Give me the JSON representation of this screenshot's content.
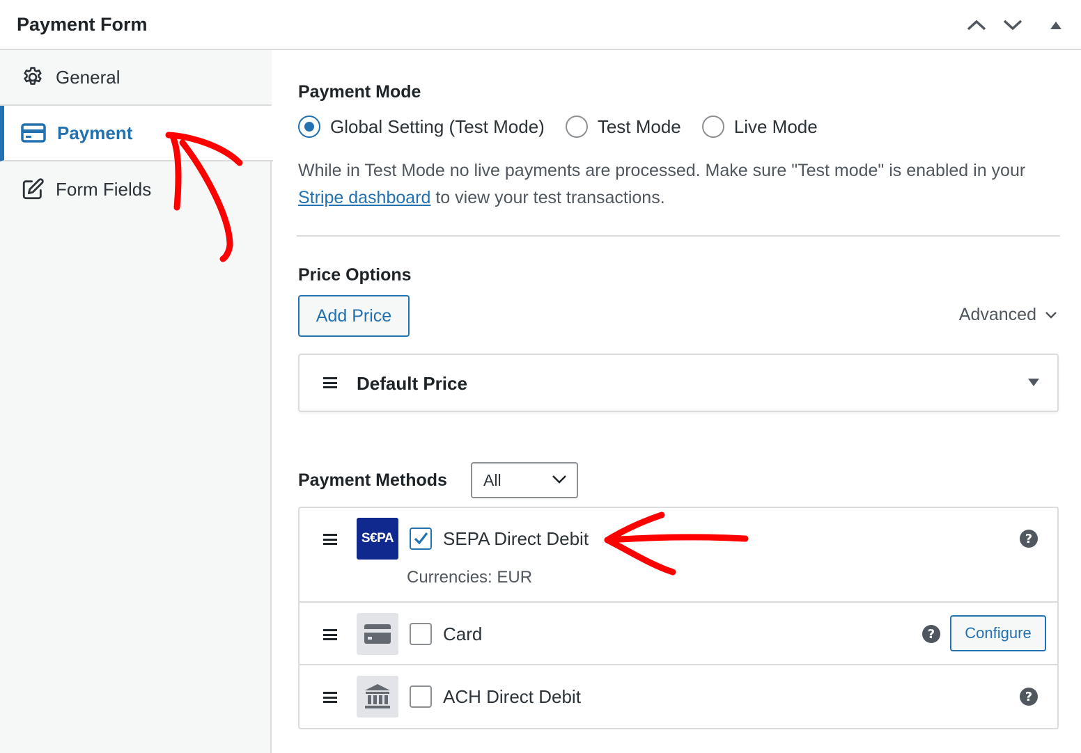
{
  "header": {
    "title": "Payment Form"
  },
  "sidebar": {
    "items": [
      {
        "label": "General",
        "icon": "gear-icon"
      },
      {
        "label": "Payment",
        "icon": "credit-card-icon",
        "active": true
      },
      {
        "label": "Form Fields",
        "icon": "edit-icon"
      }
    ]
  },
  "payment_mode": {
    "title": "Payment Mode",
    "options": [
      {
        "label": "Global Setting (Test Mode)",
        "checked": true
      },
      {
        "label": "Test Mode",
        "checked": false
      },
      {
        "label": "Live Mode",
        "checked": false
      }
    ],
    "description_before": "While in Test Mode no live payments are processed. Make sure \"Test mode\" is enabled in your ",
    "link_text": "Stripe dashboard",
    "description_after": " to view your test transactions."
  },
  "price_options": {
    "title": "Price Options",
    "add_button": "Add Price",
    "advanced_label": "Advanced",
    "default_price": "Default Price"
  },
  "payment_methods": {
    "label": "Payment Methods",
    "filter_value": "All",
    "methods": [
      {
        "name": "SEPA Direct Debit",
        "checked": true,
        "icon_text": "S€PA",
        "currencies": "Currencies: EUR"
      },
      {
        "name": "Card",
        "checked": false,
        "configure_label": "Configure"
      },
      {
        "name": "ACH Direct Debit",
        "checked": false
      }
    ]
  },
  "colors": {
    "accent": "#2271b1",
    "annotation": "#ff0000",
    "sepa_bg": "#10298e"
  }
}
